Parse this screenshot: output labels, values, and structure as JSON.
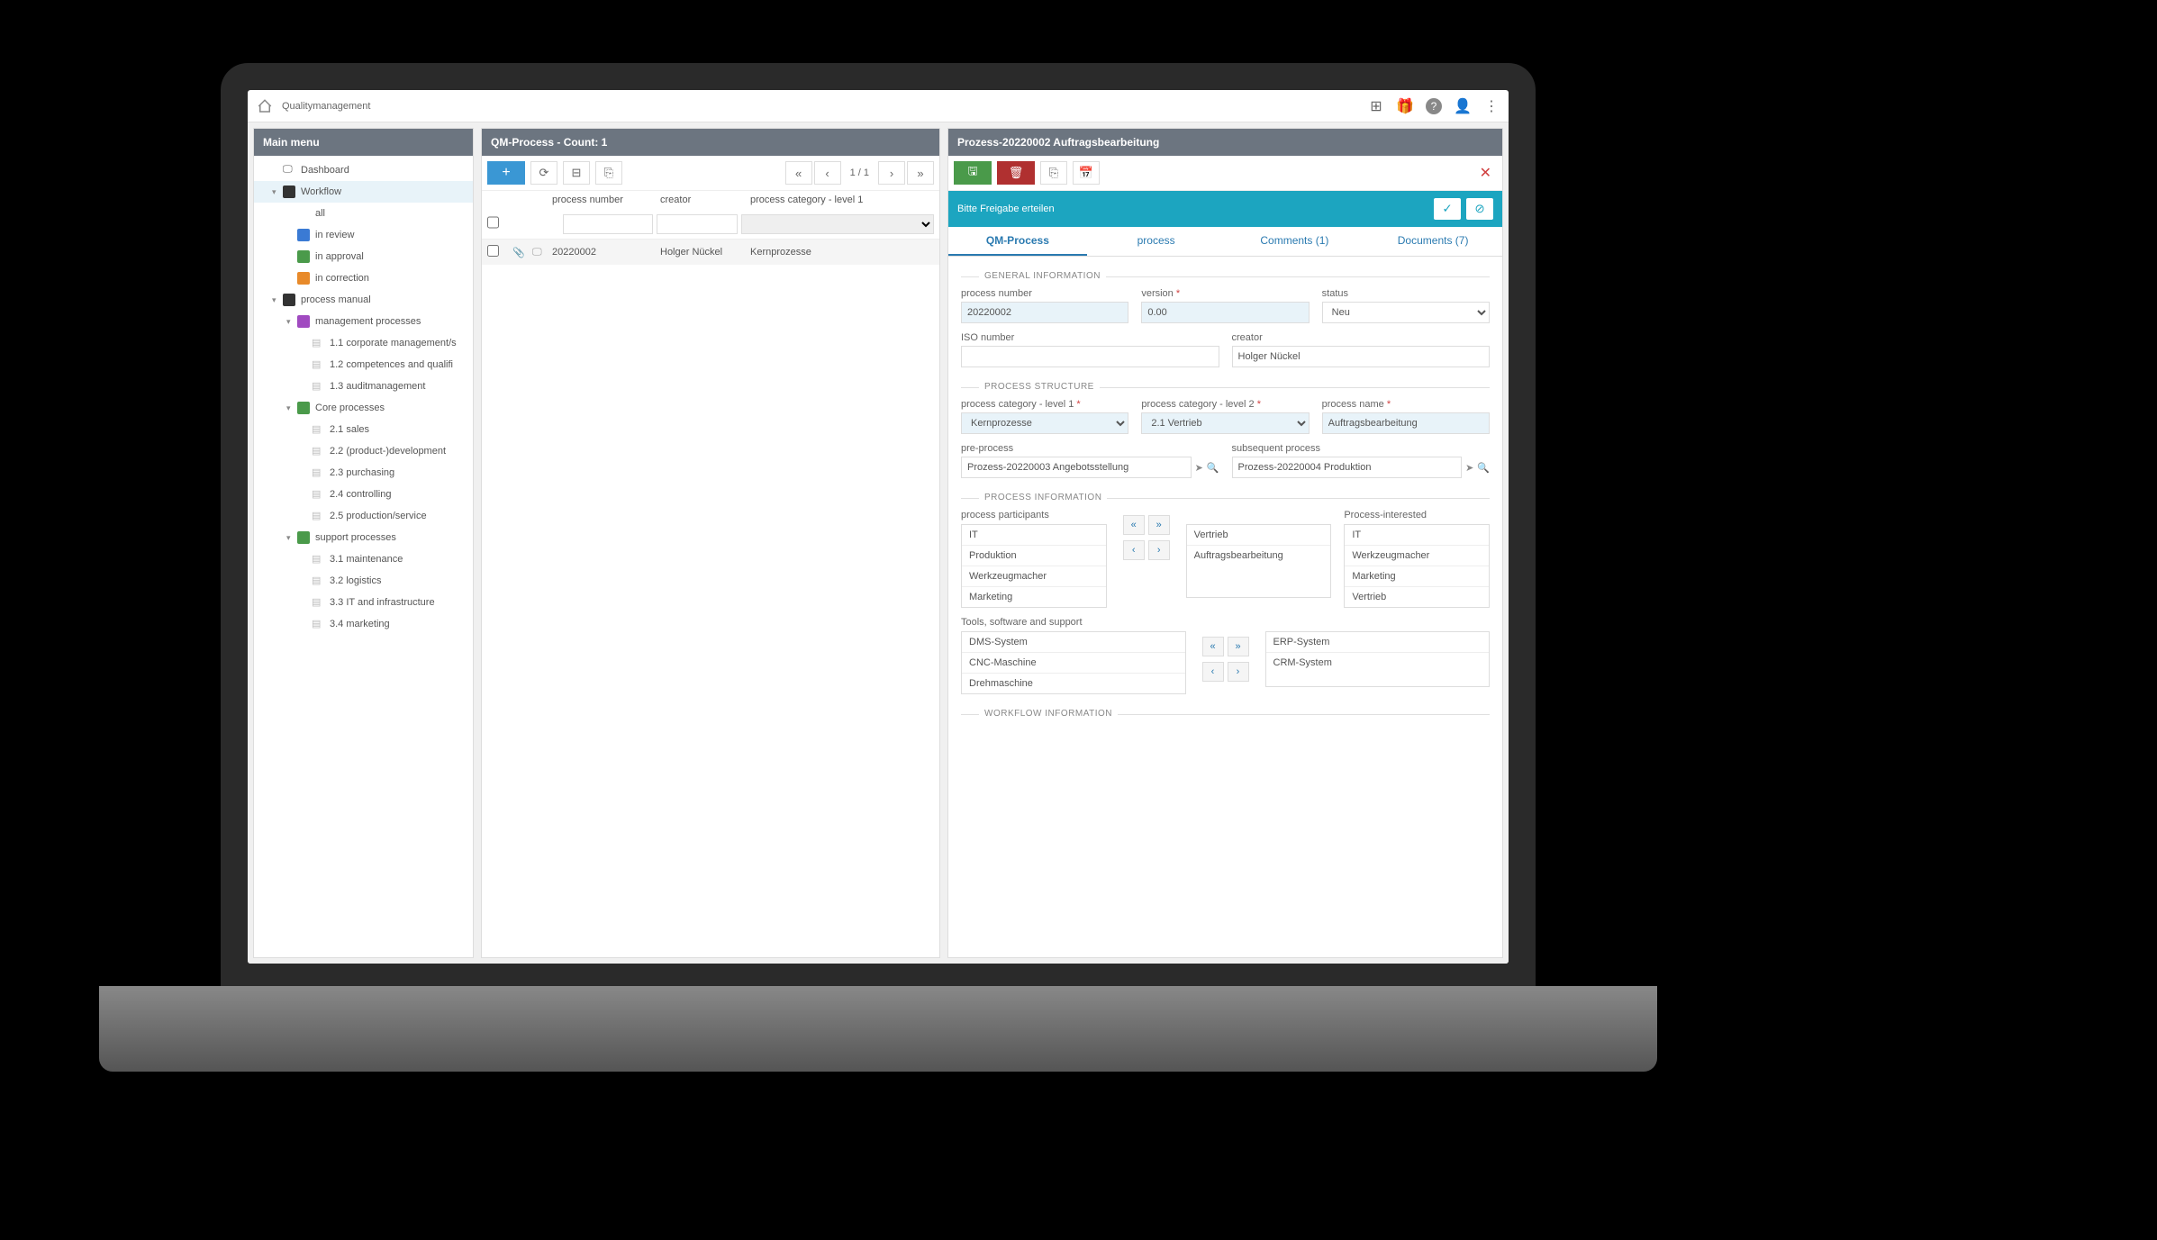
{
  "breadcrumb": "Qualitymanagement",
  "sidebar": {
    "title": "Main menu",
    "items": [
      {
        "label": "Dashboard",
        "type": "dash"
      },
      {
        "label": "Workflow",
        "type": "folder",
        "color": "#333"
      },
      {
        "label": "all",
        "indent": 2
      },
      {
        "label": "in review",
        "color": "#3a7ad4",
        "indent": 2
      },
      {
        "label": "in approval",
        "color": "#4a9a4a",
        "indent": 2
      },
      {
        "label": "in correction",
        "color": "#e88a2a",
        "indent": 2
      },
      {
        "label": "process manual",
        "type": "folder",
        "color": "#333"
      },
      {
        "label": "management processes",
        "type": "book",
        "color": "#a04ac0",
        "indent": 2
      },
      {
        "label": "1.1 corporate management/s",
        "type": "doc",
        "indent": 3
      },
      {
        "label": "1.2 competences and qualifi",
        "type": "doc",
        "indent": 3
      },
      {
        "label": "1.3 auditmanagement",
        "type": "doc",
        "indent": 3
      },
      {
        "label": "Core processes",
        "type": "book",
        "color": "#4a9a4a",
        "indent": 2
      },
      {
        "label": "2.1 sales",
        "type": "doc",
        "indent": 3
      },
      {
        "label": "2.2 (product-)development",
        "type": "doc",
        "indent": 3
      },
      {
        "label": "2.3 purchasing",
        "type": "doc",
        "indent": 3
      },
      {
        "label": "2.4 controlling",
        "type": "doc",
        "indent": 3
      },
      {
        "label": "2.5 production/service",
        "type": "doc",
        "indent": 3
      },
      {
        "label": "support processes",
        "type": "book",
        "color": "#4a9a4a",
        "indent": 2
      },
      {
        "label": "3.1 maintenance",
        "type": "doc",
        "indent": 3
      },
      {
        "label": "3.2 logistics",
        "type": "doc",
        "indent": 3
      },
      {
        "label": "3.3 IT and infrastructure",
        "type": "doc",
        "indent": 3
      },
      {
        "label": "3.4 marketing",
        "type": "doc",
        "indent": 3
      }
    ]
  },
  "list": {
    "title": "QM-Process - Count: 1",
    "pager": "1 / 1",
    "headers": {
      "pn": "process number",
      "cr": "creator",
      "cat": "process category - level 1"
    },
    "row": {
      "pn": "20220002",
      "cr": "Holger Nückel",
      "cat": "Kernprozesse"
    }
  },
  "detail": {
    "title": "Prozess-20220002 Auftragsbearbeitung",
    "approval": "Bitte Freigabe erteilen",
    "tabs": {
      "t1": "QM-Process",
      "t2": "process",
      "t3": "Comments (1)",
      "t4": "Documents (7)"
    },
    "sections": {
      "s1": "GENERAL INFORMATION",
      "s2": "PROCESS STRUCTURE",
      "s3": "PROCESS INFORMATION",
      "s4": "WORKFLOW INFORMATION"
    },
    "labels": {
      "pn": "process number",
      "ver": "version",
      "status": "status",
      "iso": "ISO number",
      "creator": "creator",
      "cat1": "process category - level 1",
      "cat2": "process category - level 2",
      "pname": "process name",
      "pre": "pre-process",
      "sub": "subsequent process",
      "participants": "process participants",
      "interested": "Process-interested",
      "tools": "Tools, software and support"
    },
    "values": {
      "pn": "20220002",
      "ver": "0.00",
      "status": "Neu",
      "iso": "",
      "creator": "Holger Nückel",
      "cat1": "Kernprozesse",
      "cat2": "2.1 Vertrieb",
      "pname": "Auftragsbearbeitung",
      "pre": "Prozess-20220003 Angebotsstellung",
      "sub": "Prozess-20220004 Produktion"
    },
    "participants_left": [
      "IT",
      "Produktion",
      "Werkzeugmacher",
      "Marketing"
    ],
    "participants_right": [
      "Vertrieb",
      "Auftragsbearbeitung"
    ],
    "interested": [
      "IT",
      "Werkzeugmacher",
      "Marketing",
      "Vertrieb"
    ],
    "tools_left": [
      "DMS-System",
      "CNC-Maschine",
      "Drehmaschine"
    ],
    "tools_right": [
      "ERP-System",
      "CRM-System"
    ]
  }
}
